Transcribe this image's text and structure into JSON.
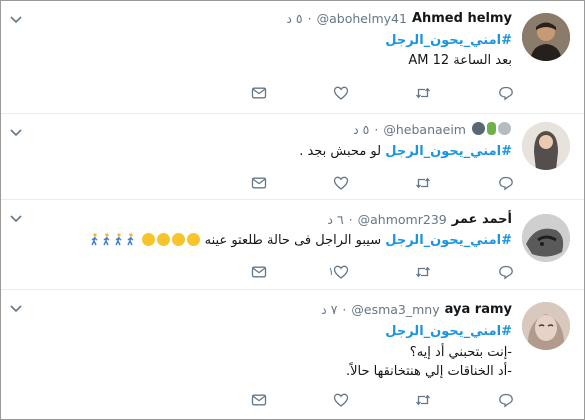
{
  "tweets": [
    {
      "name": "Ahmed helmy",
      "handle": "@abohelmy41",
      "time": "٥ د",
      "hashtag": "#امني_يحون_الرجل",
      "body": "بعد الساعة 12 AM",
      "reply_count": "",
      "retweet_count": "",
      "like_count": ""
    },
    {
      "name": "",
      "handle": "@hebanaeim",
      "time": "٥ د",
      "hashtag": "#امني_يحون_الرجل",
      "body": "لو محبش بجد .",
      "reply_count": "",
      "retweet_count": "",
      "like_count": ""
    },
    {
      "name": "أحمد عمر",
      "handle": "@ahmomr239",
      "time": "٦ د",
      "hashtag": "#امني_يحون_الرجل",
      "body": "سيبو الراجل فى حالة طلعتو عينه",
      "reply_count": "",
      "retweet_count": "",
      "like_count": "١"
    },
    {
      "name": "aya ramy",
      "handle": "@esma3_mny",
      "time": "٧ د",
      "hashtag": "#امني_يحون_الرجل",
      "body_line1": "-إنت بتحبني أد إيه؟",
      "body_line2": "-أد الخناقات إلي هنتخانقها حالاً.",
      "reply_count": "",
      "retweet_count": "",
      "like_count": ""
    }
  ],
  "icons": {
    "reply": "reply-icon",
    "retweet": "retweet-icon",
    "like": "heart-icon",
    "message": "envelope-icon",
    "caret": "chevron-down-icon"
  },
  "colors": {
    "hashtag": "#1b95e0",
    "icon": "#657786",
    "divider": "#e6ecf0"
  }
}
